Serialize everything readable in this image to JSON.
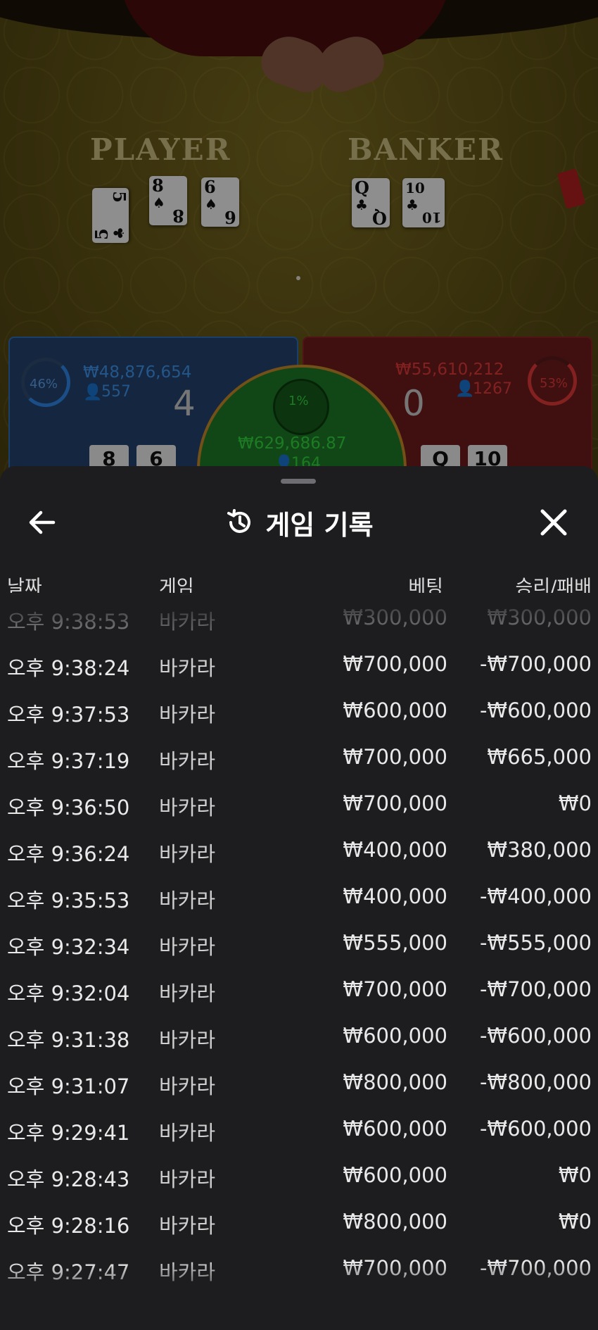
{
  "table": {
    "player_label": "PLAYER",
    "banker_label": "BANKER",
    "player_cards": [
      {
        "rank": "5",
        "suit": "♣"
      },
      {
        "rank": "8",
        "suit": "♠"
      },
      {
        "rank": "6",
        "suit": "♠"
      }
    ],
    "banker_cards": [
      {
        "rank": "Q",
        "suit": "♣"
      },
      {
        "rank": "10",
        "suit": "♣"
      }
    ]
  },
  "bets": {
    "player": {
      "percent": "46%",
      "amount": "₩48,876,654",
      "players": "557",
      "score": "4",
      "cards": [
        "8",
        "6"
      ]
    },
    "banker": {
      "percent": "53%",
      "amount": "₩55,610,212",
      "players": "1267",
      "score": "0",
      "cards": [
        "Q",
        "10"
      ]
    },
    "tie": {
      "percent": "1%",
      "amount": "₩629,686.87",
      "players": "164"
    }
  },
  "sheet": {
    "title": "게임 기록",
    "back_icon": "arrow-left-icon",
    "history_icon": "history-icon",
    "close_icon": "close-icon",
    "columns": {
      "date": "날짜",
      "game": "게임",
      "bet": "베팅",
      "result": "승리/패배"
    },
    "rows": [
      {
        "time": "오후 9:38:53",
        "game": "바카라",
        "bet": "₩300,000",
        "result": "₩300,000"
      },
      {
        "time": "오후 9:38:24",
        "game": "바카라",
        "bet": "₩700,000",
        "result": "-₩700,000"
      },
      {
        "time": "오후 9:37:53",
        "game": "바카라",
        "bet": "₩600,000",
        "result": "-₩600,000"
      },
      {
        "time": "오후 9:37:19",
        "game": "바카라",
        "bet": "₩700,000",
        "result": "₩665,000"
      },
      {
        "time": "오후 9:36:50",
        "game": "바카라",
        "bet": "₩700,000",
        "result": "₩0"
      },
      {
        "time": "오후 9:36:24",
        "game": "바카라",
        "bet": "₩400,000",
        "result": "₩380,000"
      },
      {
        "time": "오후 9:35:53",
        "game": "바카라",
        "bet": "₩400,000",
        "result": "-₩400,000"
      },
      {
        "time": "오후 9:32:34",
        "game": "바카라",
        "bet": "₩555,000",
        "result": "-₩555,000"
      },
      {
        "time": "오후 9:32:04",
        "game": "바카라",
        "bet": "₩700,000",
        "result": "-₩700,000"
      },
      {
        "time": "오후 9:31:38",
        "game": "바카라",
        "bet": "₩600,000",
        "result": "-₩600,000"
      },
      {
        "time": "오후 9:31:07",
        "game": "바카라",
        "bet": "₩800,000",
        "result": "-₩800,000"
      },
      {
        "time": "오후 9:29:41",
        "game": "바카라",
        "bet": "₩600,000",
        "result": "-₩600,000"
      },
      {
        "time": "오후 9:28:43",
        "game": "바카라",
        "bet": "₩600,000",
        "result": "₩0"
      },
      {
        "time": "오후 9:28:16",
        "game": "바카라",
        "bet": "₩800,000",
        "result": "₩0"
      },
      {
        "time": "오후 9:27:47",
        "game": "바카라",
        "bet": "₩700,000",
        "result": "-₩700,000"
      }
    ]
  },
  "colors": {
    "player_blue": "#2f86e8",
    "banker_red": "#d42a2a",
    "tie_green": "#2bd13a",
    "sheet_bg": "#1d1d1f"
  }
}
